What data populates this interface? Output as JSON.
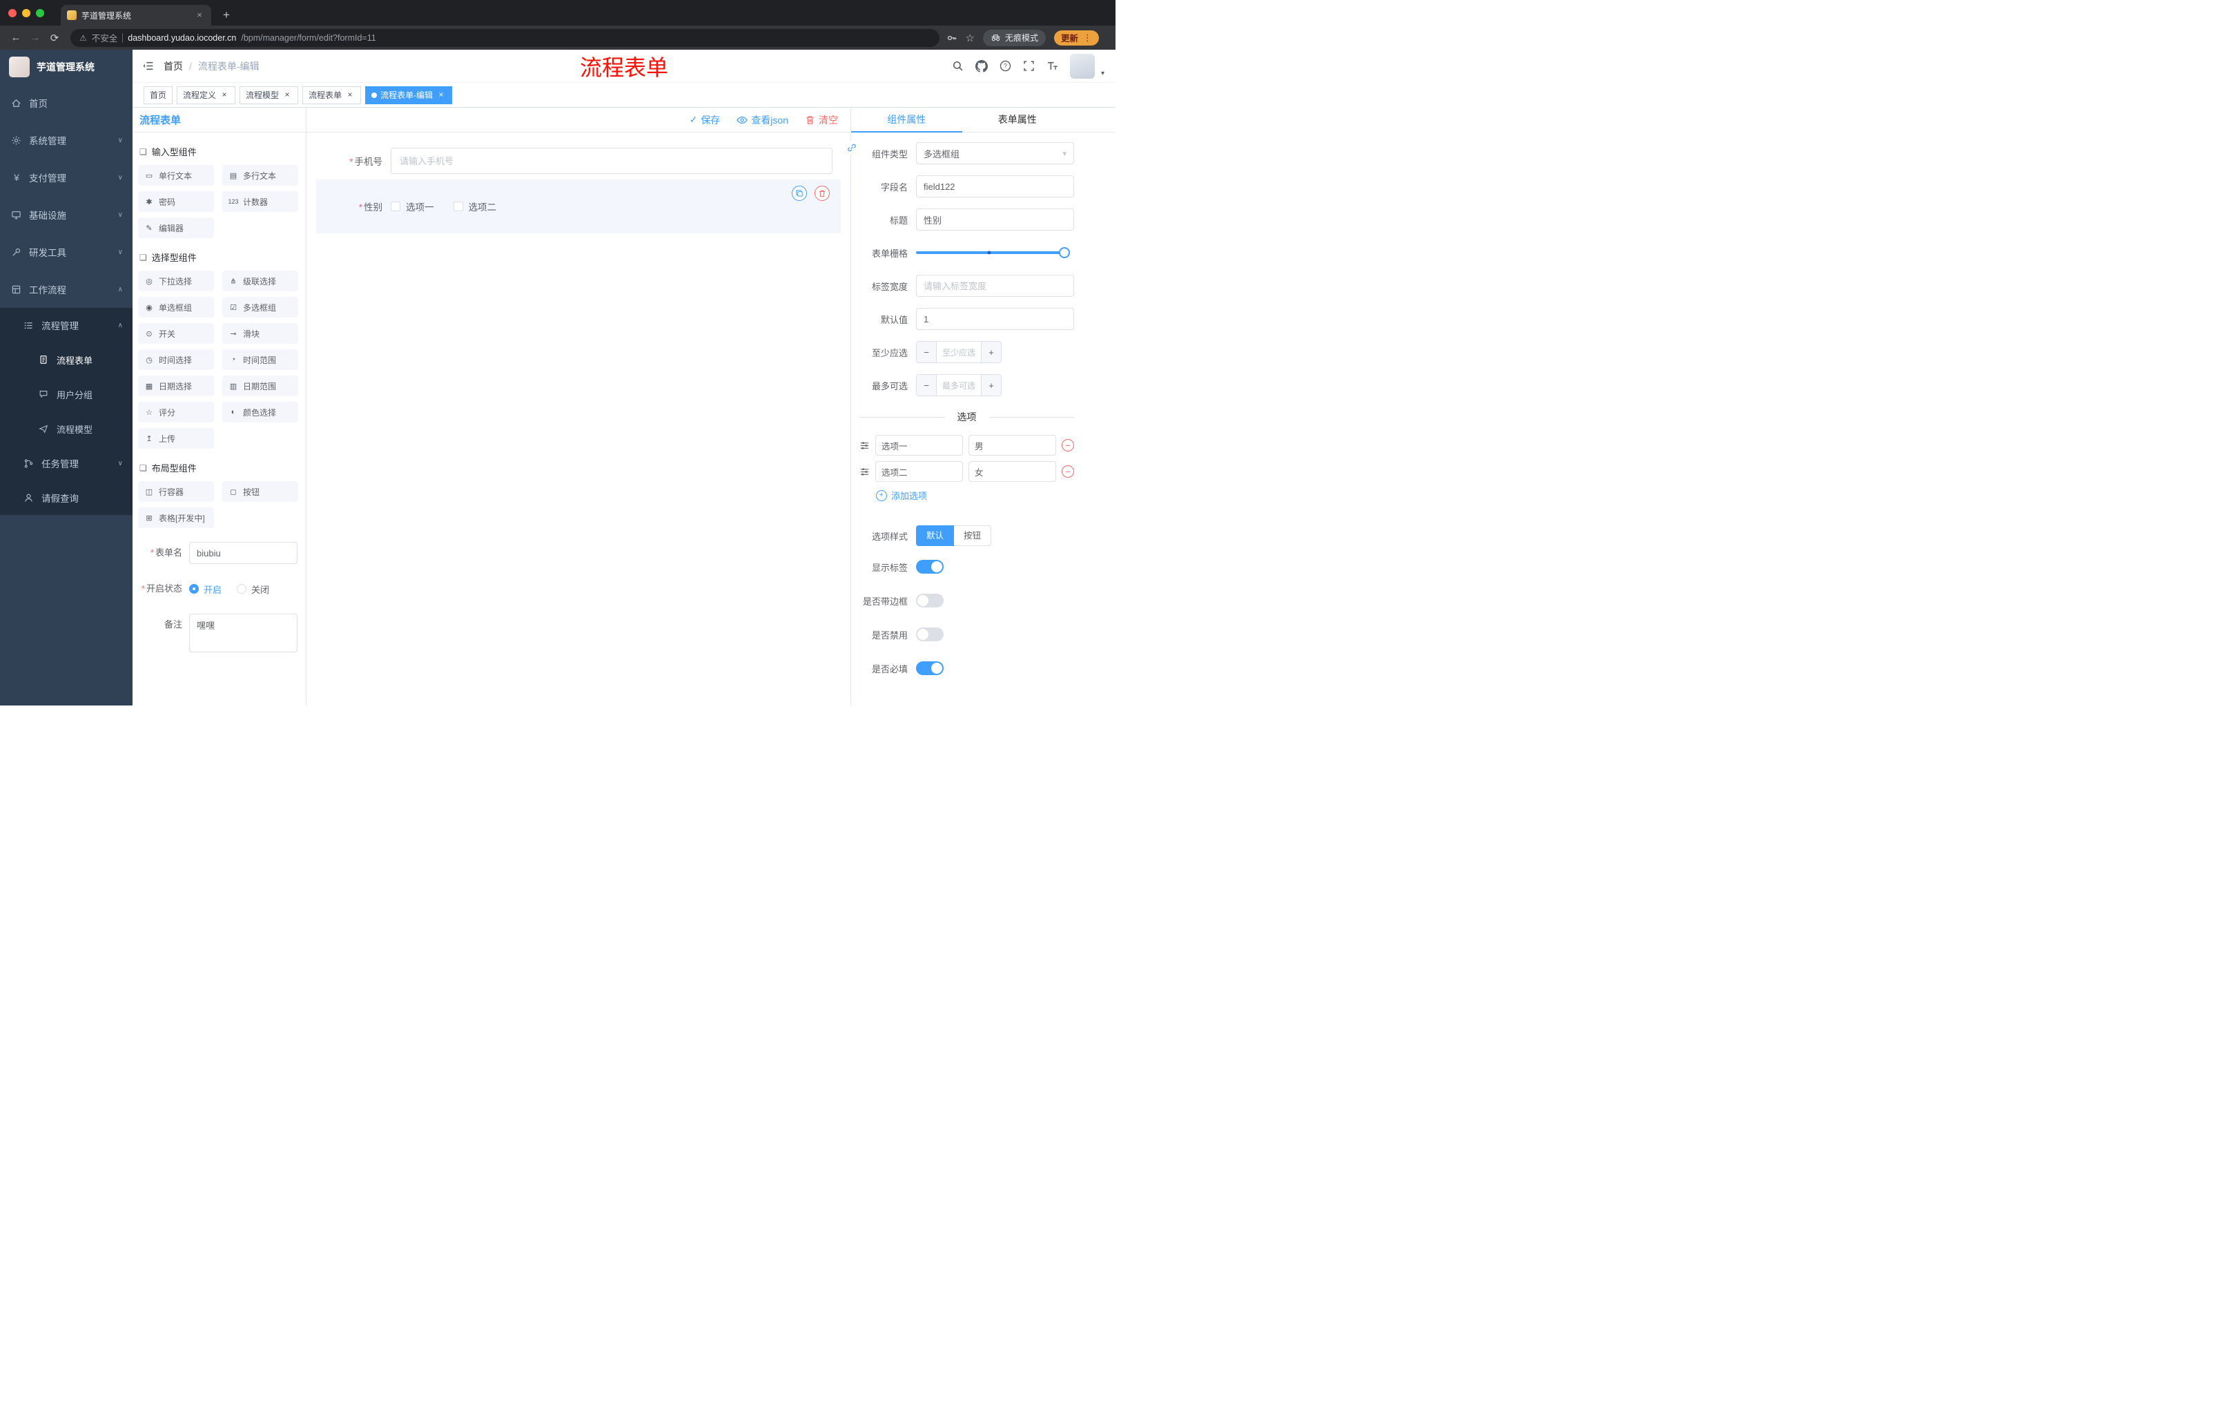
{
  "browser": {
    "tab_title": "芋道管理系统",
    "security_text": "不安全",
    "url_host": "dashboard.yudao.iocoder.cn",
    "url_path": "/bpm/manager/form/edit?formId=11",
    "incognito_label": "无痕模式",
    "update_label": "更新"
  },
  "sidebar": {
    "app_title": "芋道管理系统",
    "items": [
      {
        "icon": "home-icon",
        "label": "首页"
      },
      {
        "icon": "gear-icon",
        "label": "系统管理"
      },
      {
        "icon": "yen-icon",
        "label": "支付管理"
      },
      {
        "icon": "infra-icon",
        "label": "基础设施"
      },
      {
        "icon": "devtools-icon",
        "label": "研发工具"
      },
      {
        "icon": "workflow-icon",
        "label": "工作流程"
      },
      {
        "icon": "list-icon",
        "label": "流程管理"
      },
      {
        "icon": "form-icon",
        "label": "流程表单"
      },
      {
        "icon": "chat-icon",
        "label": "用户分组"
      },
      {
        "icon": "send-icon",
        "label": "流程模型"
      },
      {
        "icon": "branch-icon",
        "label": "任务管理"
      },
      {
        "icon": "person-icon",
        "label": "请假查询"
      }
    ]
  },
  "header": {
    "breadcrumb": {
      "home": "首页",
      "separator": "/",
      "current": "流程表单-编辑"
    },
    "annotation": "流程表单"
  },
  "tags": [
    {
      "label": "首页"
    },
    {
      "label": "流程定义"
    },
    {
      "label": "流程模型"
    },
    {
      "label": "流程表单"
    },
    {
      "label": "流程表单-编辑"
    }
  ],
  "designer": {
    "title": "流程表单",
    "toolbar": {
      "save": "保存",
      "view_json": "查看json",
      "clear": "清空"
    },
    "groups": [
      {
        "title": "输入型组件",
        "items": [
          {
            "icon": "▭",
            "label": "单行文本"
          },
          {
            "icon": "▤",
            "label": "多行文本"
          },
          {
            "icon": "✱",
            "label": "密码"
          },
          {
            "icon": "123",
            "label": "计数器"
          },
          {
            "icon": "✎",
            "label": "编辑器"
          }
        ]
      },
      {
        "title": "选择型组件",
        "items": [
          {
            "icon": "◎",
            "label": "下拉选择"
          },
          {
            "icon": "⋔",
            "label": "级联选择"
          },
          {
            "icon": "◉",
            "label": "单选框组"
          },
          {
            "icon": "☑",
            "label": "多选框组"
          },
          {
            "icon": "⊙",
            "label": "开关"
          },
          {
            "icon": "⊸",
            "label": "滑块"
          },
          {
            "icon": "◷",
            "label": "时间选择"
          },
          {
            "icon": "◔",
            "label": "时间范围"
          },
          {
            "icon": "▦",
            "label": "日期选择"
          },
          {
            "icon": "▥",
            "label": "日期范围"
          },
          {
            "icon": "☆",
            "label": "评分"
          },
          {
            "icon": "◐",
            "label": "颜色选择"
          },
          {
            "icon": "↥",
            "label": "上传"
          }
        ]
      },
      {
        "title": "布局型组件",
        "items": [
          {
            "icon": "◫",
            "label": "行容器"
          },
          {
            "icon": "◻",
            "label": "按钮"
          },
          {
            "icon": "⊞",
            "label": "表格[开发中]"
          }
        ]
      }
    ],
    "meta": {
      "form_name_label": "表单名",
      "form_name_value": "biubiu",
      "status_label": "开启状态",
      "status_on": "开启",
      "status_off": "关闭",
      "remark_label": "备注",
      "remark_value": "嘿嘿"
    },
    "canvas": {
      "phone_label": "手机号",
      "phone_placeholder": "请输入手机号",
      "gender_label": "性别",
      "gender_options": [
        {
          "label": "选项一"
        },
        {
          "label": "选项二"
        }
      ]
    }
  },
  "props": {
    "tabs": {
      "component": "组件属性",
      "form": "表单属性"
    },
    "component_type": {
      "label": "组件类型",
      "value": "多选框组"
    },
    "field_name": {
      "label": "字段名",
      "value": "field122"
    },
    "title": {
      "label": "标题",
      "value": "性别"
    },
    "grid": {
      "label": "表单栅格"
    },
    "label_width": {
      "label": "标签宽度",
      "placeholder": "请输入标签宽度"
    },
    "default_value": {
      "label": "默认值",
      "value": "1"
    },
    "min_select": {
      "label": "至少应选",
      "placeholder": "至少应选"
    },
    "max_select": {
      "label": "最多可选",
      "placeholder": "最多可选"
    },
    "options": {
      "divider_title": "选项",
      "rows": [
        {
          "label": "选项一",
          "value": "男"
        },
        {
          "label": "选项二",
          "value": "女"
        }
      ],
      "add_label": "添加选项"
    },
    "option_style": {
      "label": "选项样式",
      "choices": [
        {
          "label": "默认"
        },
        {
          "label": "按钮"
        }
      ]
    },
    "switches": [
      {
        "label": "显示标签",
        "on": true
      },
      {
        "label": "是否带边框",
        "on": false
      },
      {
        "label": "是否禁用",
        "on": false
      },
      {
        "label": "是否必填",
        "on": true
      }
    ]
  },
  "icons": {
    "close": "×",
    "plus": "+",
    "minus": "−",
    "check": "✓",
    "chevron_down": "∨",
    "chevron_up": "∧",
    "caret_down": "▾",
    "required": "*",
    "ellipsis": "⋮",
    "warning": "⚠",
    "star": "☆",
    "group_marker": "❏",
    "back": "←",
    "forward": "→",
    "reload": "⟳",
    "new_tab": "+",
    "yen": "¥",
    "question": "?"
  }
}
